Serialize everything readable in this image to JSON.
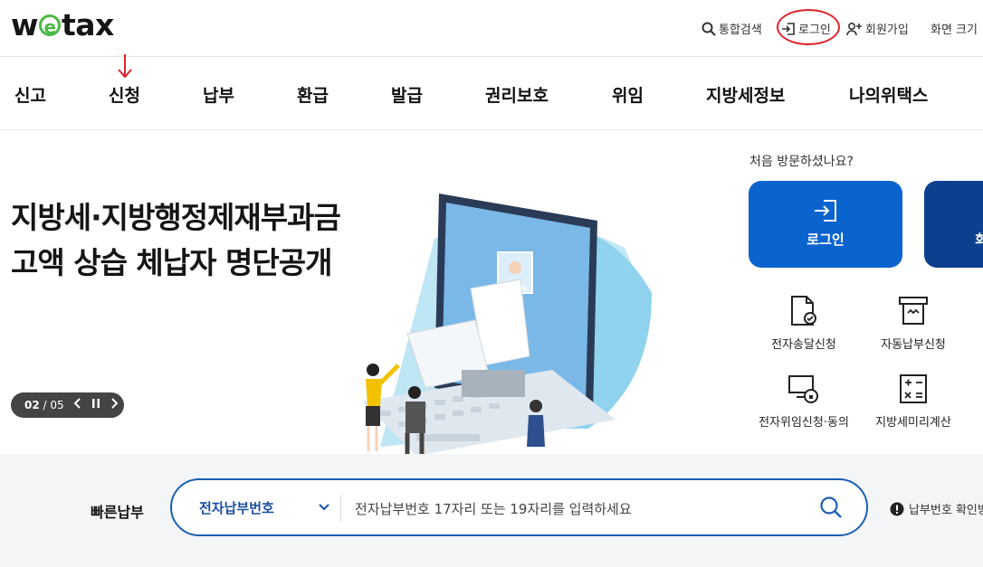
{
  "logo": {
    "pre": "w",
    "e": "e",
    "post": "tax"
  },
  "util": {
    "search": "통합검색",
    "login": "로그인",
    "join": "회원가입",
    "font_size": "화면 크기"
  },
  "gnb": [
    "신고",
    "신청",
    "납부",
    "환급",
    "발급",
    "권리보호",
    "위임",
    "지방세정보",
    "나의위택스"
  ],
  "hero": {
    "title_line1": "지방세·지방행정제재부과금",
    "title_line2": "고액 상습 체납자 명단공개",
    "pager_current": "02",
    "pager_total": "/ 05"
  },
  "side": {
    "visit_question": "처음 방문하셨나요?",
    "login_button": "로그인",
    "second_button": "회",
    "quick": [
      "전자송달신청",
      "자동납부신청",
      "전자위임신청·동의",
      "지방세미리계산"
    ]
  },
  "fastpay": {
    "label": "빠른납부",
    "select_value": "전자납부번호",
    "placeholder": "전자납부번호 17자리 또는 19자리를 입력하세요",
    "info": "납부번호 확인방법"
  },
  "colors": {
    "brand_green": "#4cb847",
    "primary_blue": "#0b63ce",
    "dark_blue": "#0d3f8f",
    "annotation_red": "#e0212b"
  }
}
